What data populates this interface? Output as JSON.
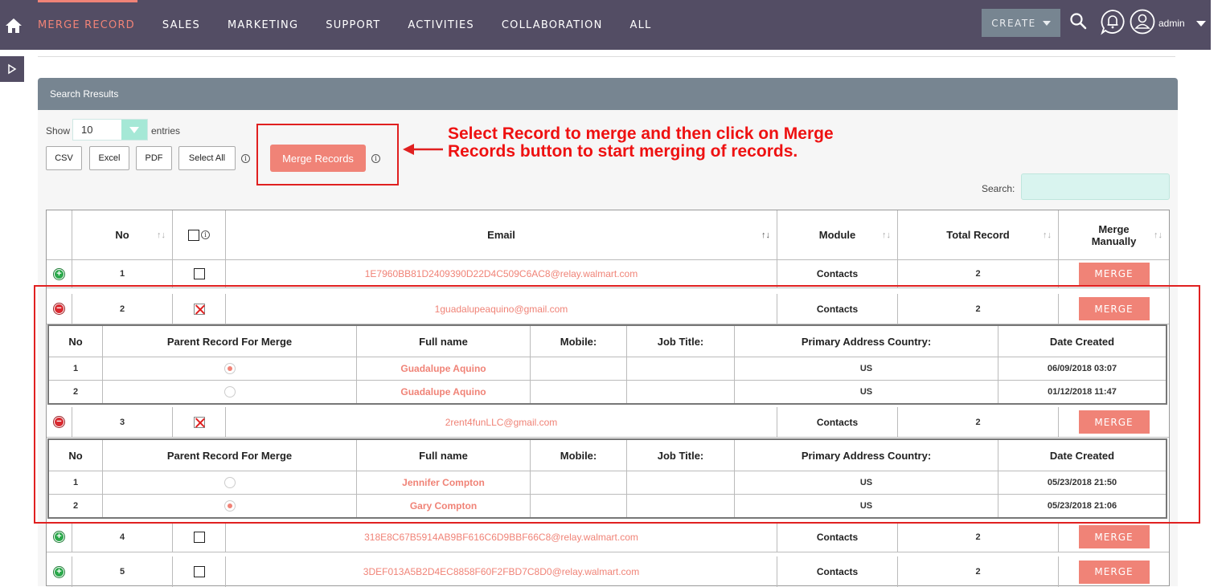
{
  "nav": {
    "items": [
      "MERGE RECORD",
      "SALES",
      "MARKETING",
      "SUPPORT",
      "ACTIVITIES",
      "COLLABORATION",
      "ALL"
    ],
    "create_label": "CREATE",
    "user_label": "admin"
  },
  "panel": {
    "title": "Search Rresults"
  },
  "controls": {
    "show_label": "Show",
    "entries_value": "10",
    "entries_label": "entries",
    "csv": "CSV",
    "excel": "Excel",
    "pdf": "PDF",
    "select_all": "Select All",
    "merge_records": "Merge Records",
    "search_label": "Search:",
    "info_glyph": "i"
  },
  "annotation": {
    "line1": "Select Record to merge and then click on Merge",
    "line2": "Records button to start merging of records."
  },
  "table": {
    "headers": {
      "no": "No",
      "email": "Email",
      "module": "Module",
      "total": "Total Record",
      "merge": "Merge Manually"
    },
    "merge_label": "MERGE",
    "rows": [
      {
        "no": "1",
        "email": "1E7960BB81D2409390D22D4C509C6AC8@relay.walmart.com",
        "module": "Contacts",
        "total": "2",
        "expanded": false,
        "checked": false
      },
      {
        "no": "2",
        "email": "1guadalupeaquino@gmail.com",
        "module": "Contacts",
        "total": "2",
        "expanded": true,
        "checked": true
      },
      {
        "no": "3",
        "email": "2rent4funLLC@gmail.com",
        "module": "Contacts",
        "total": "2",
        "expanded": true,
        "checked": true
      },
      {
        "no": "4",
        "email": "318E8C67B5914AB9BF616C6D9BBF66C8@relay.walmart.com",
        "module": "Contacts",
        "total": "2",
        "expanded": false,
        "checked": false
      },
      {
        "no": "5",
        "email": "3DEF013A5B2D4EC8858F60F2FBD7C8D0@relay.walmart.com",
        "module": "Contacts",
        "total": "2",
        "expanded": false,
        "checked": false
      }
    ]
  },
  "sub_headers": {
    "no": "No",
    "parent": "Parent Record For Merge",
    "fullname": "Full name",
    "mobile": "Mobile:",
    "job": "Job Title:",
    "country": "Primary Address Country:",
    "date": "Date Created"
  },
  "sub_tables": [
    {
      "rows": [
        {
          "no": "1",
          "parent": true,
          "fullname": "Guadalupe Aquino",
          "mobile": "",
          "job": "",
          "country": "US",
          "date": "06/09/2018 03:07"
        },
        {
          "no": "2",
          "parent": false,
          "fullname": "Guadalupe Aquino",
          "mobile": "",
          "job": "",
          "country": "US",
          "date": "01/12/2018 11:47"
        }
      ]
    },
    {
      "rows": [
        {
          "no": "1",
          "parent": false,
          "fullname": "Jennifer Compton",
          "mobile": "",
          "job": "",
          "country": "US",
          "date": "05/23/2018 21:50"
        },
        {
          "no": "2",
          "parent": true,
          "fullname": "Gary Compton",
          "mobile": "",
          "job": "",
          "country": "US",
          "date": "05/23/2018 21:06"
        }
      ]
    }
  ]
}
